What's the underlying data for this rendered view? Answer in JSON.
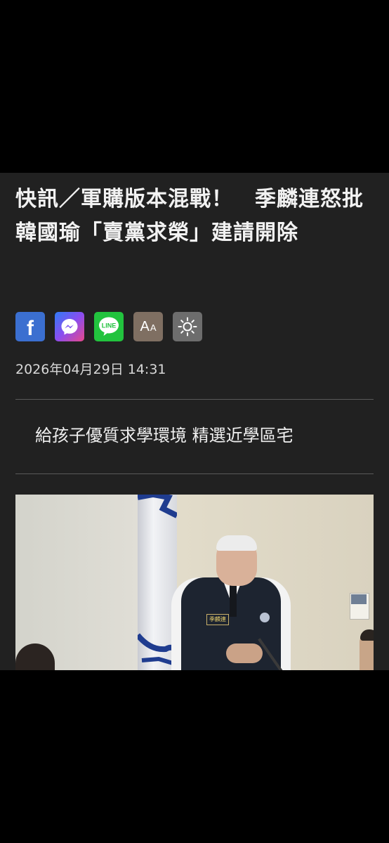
{
  "article": {
    "headline": "快訊／軍購版本混戰！　季麟連怒批韓國瑜「賣黨求榮」建請開除",
    "date": "2026年04月29日 14:31"
  },
  "share": {
    "buttons": [
      {
        "name": "facebook",
        "icon": "facebook-icon",
        "color": "#3b6fd0"
      },
      {
        "name": "messenger",
        "icon": "messenger-icon",
        "color": "#8a4df0"
      },
      {
        "name": "line",
        "icon": "line-icon",
        "label": "LINE",
        "color": "#22c33e"
      },
      {
        "name": "font-size",
        "icon": "font-size-icon",
        "label_big": "A",
        "label_small": "A",
        "color": "#7f6f62"
      },
      {
        "name": "brightness",
        "icon": "brightness-icon",
        "color": "#6d6d6d"
      }
    ]
  },
  "promo": {
    "text": "給孩子優質求學環境 精選近學區宅"
  },
  "photo": {
    "badge_text": "季麟連"
  },
  "colors": {
    "background": "#000000",
    "panel": "#212121",
    "text": "#f2f2f2",
    "divider": "#5a5a5a"
  }
}
